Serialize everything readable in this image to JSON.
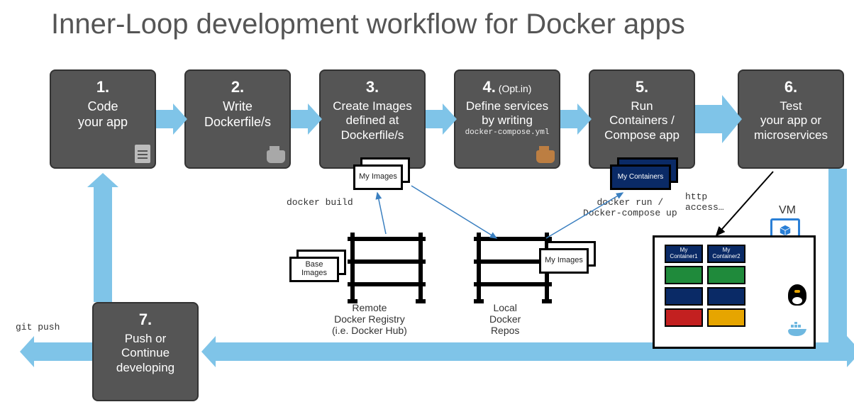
{
  "title": "Inner-Loop development workflow for Docker apps",
  "steps": {
    "s1": {
      "num": "1.",
      "text": "Code\nyour app"
    },
    "s2": {
      "num": "2.",
      "text": "Write\nDockerfile/s"
    },
    "s3": {
      "num": "3.",
      "text": "Create Images\ndefined at\nDockerfile/s"
    },
    "s4": {
      "num": "4.",
      "opt": " (Opt.in)",
      "text": "Define services\nby writing",
      "code": "docker-compose.yml"
    },
    "s5": {
      "num": "5.",
      "text": "Run\nContainers /\nCompose app"
    },
    "s6": {
      "num": "6.",
      "text": "Test\nyour app or\nmicroservices"
    },
    "s7": {
      "num": "7.",
      "text": "Push or\nContinue\ndeveloping"
    }
  },
  "labels": {
    "docker_build": "docker build",
    "docker_run": "docker run /\nDocker-compose up",
    "http_access": "http\naccess…",
    "git_push": "git push",
    "vm": "VM",
    "remote_registry": "Remote\nDocker Registry\n(i.e. Docker Hub)",
    "local_repos": "Local\nDocker\nRepos",
    "my_images": "My\nImages",
    "base_images": "Base\nImages",
    "my_containers": "My\nContainers",
    "my_container_1": "My\nContainer1",
    "my_container_2": "My\nContainer2"
  },
  "colors": {
    "arrow_blue": "#7fc4e8",
    "step_bg": "#555555",
    "navy": "#0a2a66",
    "green": "#1f8a3b",
    "red": "#c32020",
    "gold": "#e6a500"
  }
}
